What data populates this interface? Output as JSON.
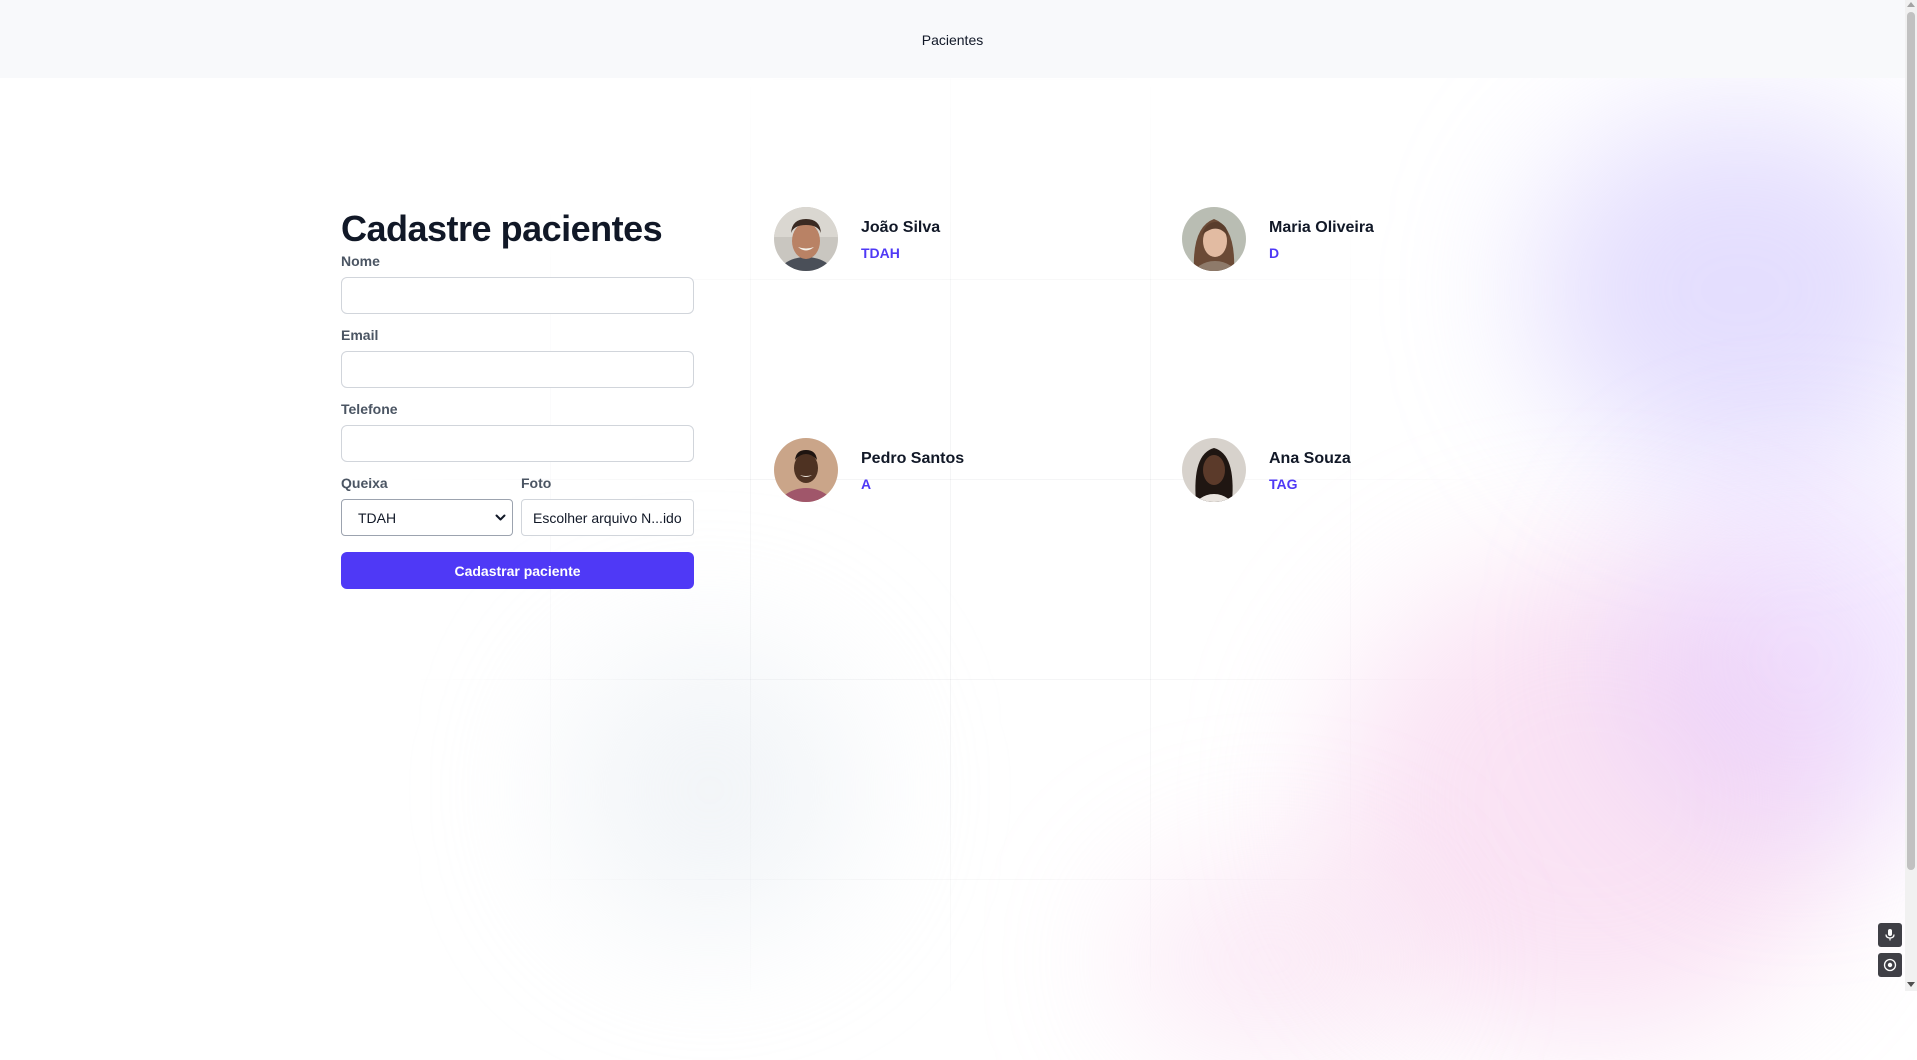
{
  "nav": {
    "link_label": "Pacientes"
  },
  "form": {
    "title": "Cadastre pacientes",
    "name_label": "Nome",
    "name_value": "",
    "email_label": "Email",
    "email_value": "",
    "phone_label": "Telefone",
    "phone_value": "",
    "complaint_label": "Queixa",
    "complaint_selected": "TDAH",
    "photo_label": "Foto",
    "file_text": "Escolher arquivo N...ido",
    "submit_label": "Cadastrar paciente"
  },
  "patients": [
    {
      "name": "João Silva",
      "complaint": "TDAH"
    },
    {
      "name": "Maria Oliveira",
      "complaint": "D"
    },
    {
      "name": "Pedro Santos",
      "complaint": "A"
    },
    {
      "name": "Ana Souza",
      "complaint": "TAG"
    }
  ],
  "colors": {
    "accent": "#4f39f6",
    "topbar_bg": "#f8f9fb",
    "heading": "#111827",
    "label": "#4b5563"
  },
  "icons": {
    "select_chevron": "chevron-down-icon",
    "mic": "microphone-icon",
    "record": "record-icon"
  }
}
